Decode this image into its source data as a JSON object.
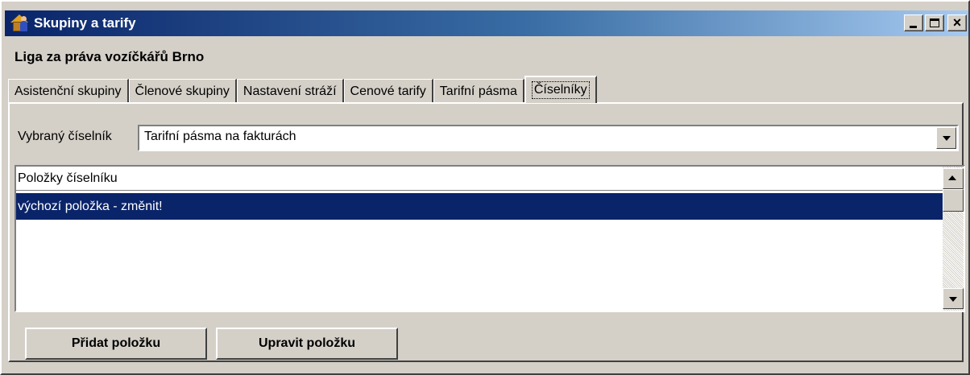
{
  "window": {
    "title": "Skupiny a tarify",
    "controls": {
      "minimize_icon": "minimize-icon",
      "maximize_icon": "maximize-icon",
      "close_label": "×"
    }
  },
  "organization": "Liga za práva vozíčkářů Brno",
  "tabs": [
    {
      "label": "Asistenční skupiny",
      "active": false
    },
    {
      "label": "Členové skupiny",
      "active": false
    },
    {
      "label": "Nastavení stráží",
      "active": false
    },
    {
      "label": "Cenové tarify",
      "active": false
    },
    {
      "label": "Tarifní pásma",
      "active": false
    },
    {
      "label": "Číselníky",
      "active": true
    }
  ],
  "selector": {
    "label": "Vybraný číselník",
    "value": "Tarifní pásma na fakturách"
  },
  "list": {
    "header": "Položky číselníku",
    "items": [
      {
        "label": "výchozí položka - změnit!",
        "selected": true
      }
    ]
  },
  "buttons": {
    "add": "Přidat položku",
    "edit": "Upravit položku"
  },
  "colors": {
    "selection": "#0a246a",
    "face": "#d4d0c8",
    "title_start": "#0a246a",
    "title_end": "#a6caf0"
  }
}
